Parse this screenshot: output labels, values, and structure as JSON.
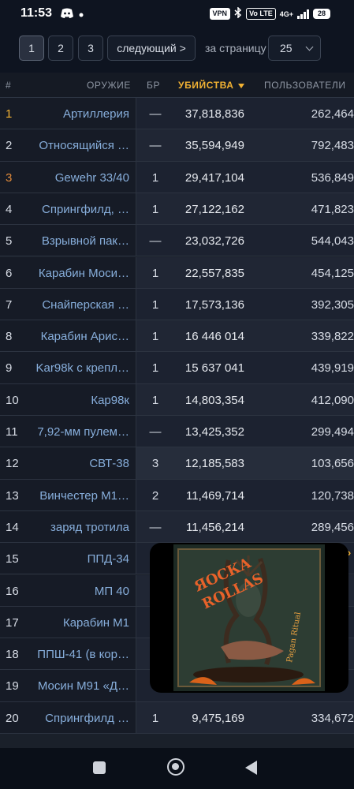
{
  "status_bar": {
    "time": "11:53",
    "vpn": "VPN",
    "volte": "Vo LTE",
    "network": "4G+",
    "battery": "28"
  },
  "pagination": {
    "pages": [
      "1",
      "2",
      "3"
    ],
    "active_page": "1",
    "next_label": "следующий >",
    "per_page_label": "за страницу",
    "per_page_value": "25"
  },
  "table": {
    "headers": {
      "rank": "#",
      "weapon": "ОРУЖИЕ",
      "br": "БР",
      "kills": "УБИЙСТВА",
      "users": "ПОЛЬЗОВАТЕЛИ"
    },
    "rows": [
      {
        "rank": "1",
        "weapon": "Артиллерия",
        "br": "—",
        "kills": "37,818,836",
        "users": "262,464"
      },
      {
        "rank": "2",
        "weapon": "Относящийся …",
        "br": "—",
        "kills": "35,594,949",
        "users": "792,483"
      },
      {
        "rank": "3",
        "weapon": "Gewehr 33/40",
        "br": "1",
        "kills": "29,417,104",
        "users": "536,849"
      },
      {
        "rank": "4",
        "weapon": "Спрингфилд, …",
        "br": "1",
        "kills": "27,122,162",
        "users": "471,823"
      },
      {
        "rank": "5",
        "weapon": "Взрывной пак…",
        "br": "—",
        "kills": "23,032,726",
        "users": "544,043"
      },
      {
        "rank": "6",
        "weapon": "Карабин Моси…",
        "br": "1",
        "kills": "22,557,835",
        "users": "454,125"
      },
      {
        "rank": "7",
        "weapon": "Снайперская …",
        "br": "1",
        "kills": "17,573,136",
        "users": "392,305"
      },
      {
        "rank": "8",
        "weapon": "Карабин Арис…",
        "br": "1",
        "kills": "16 446 014",
        "users": "339,822"
      },
      {
        "rank": "9",
        "weapon": "Kar98k с крепл…",
        "br": "1",
        "kills": "15 637 041",
        "users": "439,919"
      },
      {
        "rank": "10",
        "weapon": "Кар98к",
        "br": "1",
        "kills": "14,803,354",
        "users": "412,090"
      },
      {
        "rank": "11",
        "weapon": "7,92-мм пулем…",
        "br": "—",
        "kills": "13,425,352",
        "users": "299,494"
      },
      {
        "rank": "12",
        "weapon": "СВТ-38",
        "br": "3",
        "kills": "12,185,583",
        "users": "103,656"
      },
      {
        "rank": "13",
        "weapon": "Винчестер М1…",
        "br": "2",
        "kills": "11,469,714",
        "users": "120,738"
      },
      {
        "rank": "14",
        "weapon": "заряд тротила",
        "br": "—",
        "kills": "11,456,214",
        "users": "289,456"
      },
      {
        "rank": "15",
        "weapon": "ППД-34",
        "br": "",
        "kills": "",
        "users": ""
      },
      {
        "rank": "16",
        "weapon": "МП 40",
        "br": "",
        "kills": "",
        "users": ""
      },
      {
        "rank": "17",
        "weapon": "Карабин М1",
        "br": "",
        "kills": "",
        "users": ""
      },
      {
        "rank": "18",
        "weapon": "ППШ-41 (в кор…",
        "br": "",
        "kills": "",
        "users": ""
      },
      {
        "rank": "19",
        "weapon": "Мосин М91 «Д…",
        "br": "",
        "kills": "",
        "users": ""
      },
      {
        "rank": "20",
        "weapon": "Спрингфилд …",
        "br": "1",
        "kills": "9,475,169",
        "users": "334,672"
      }
    ]
  },
  "pip": {
    "band": "ЯОСКА ROLLAS",
    "album": "Pagan Ritual"
  },
  "colors": {
    "background": "#0e1420",
    "accent_sort": "#f2b233",
    "weapon_link": "#87aedb",
    "rank_gold": "#f2b233",
    "rank_bronze": "#e08a3a"
  },
  "icons": [
    "discord-icon",
    "vpn-icon",
    "bluetooth-icon",
    "signal-icon",
    "battery-icon",
    "nav-recents-icon",
    "nav-home-icon",
    "nav-back-icon",
    "chevron-down-icon",
    "sort-desc-icon"
  ]
}
